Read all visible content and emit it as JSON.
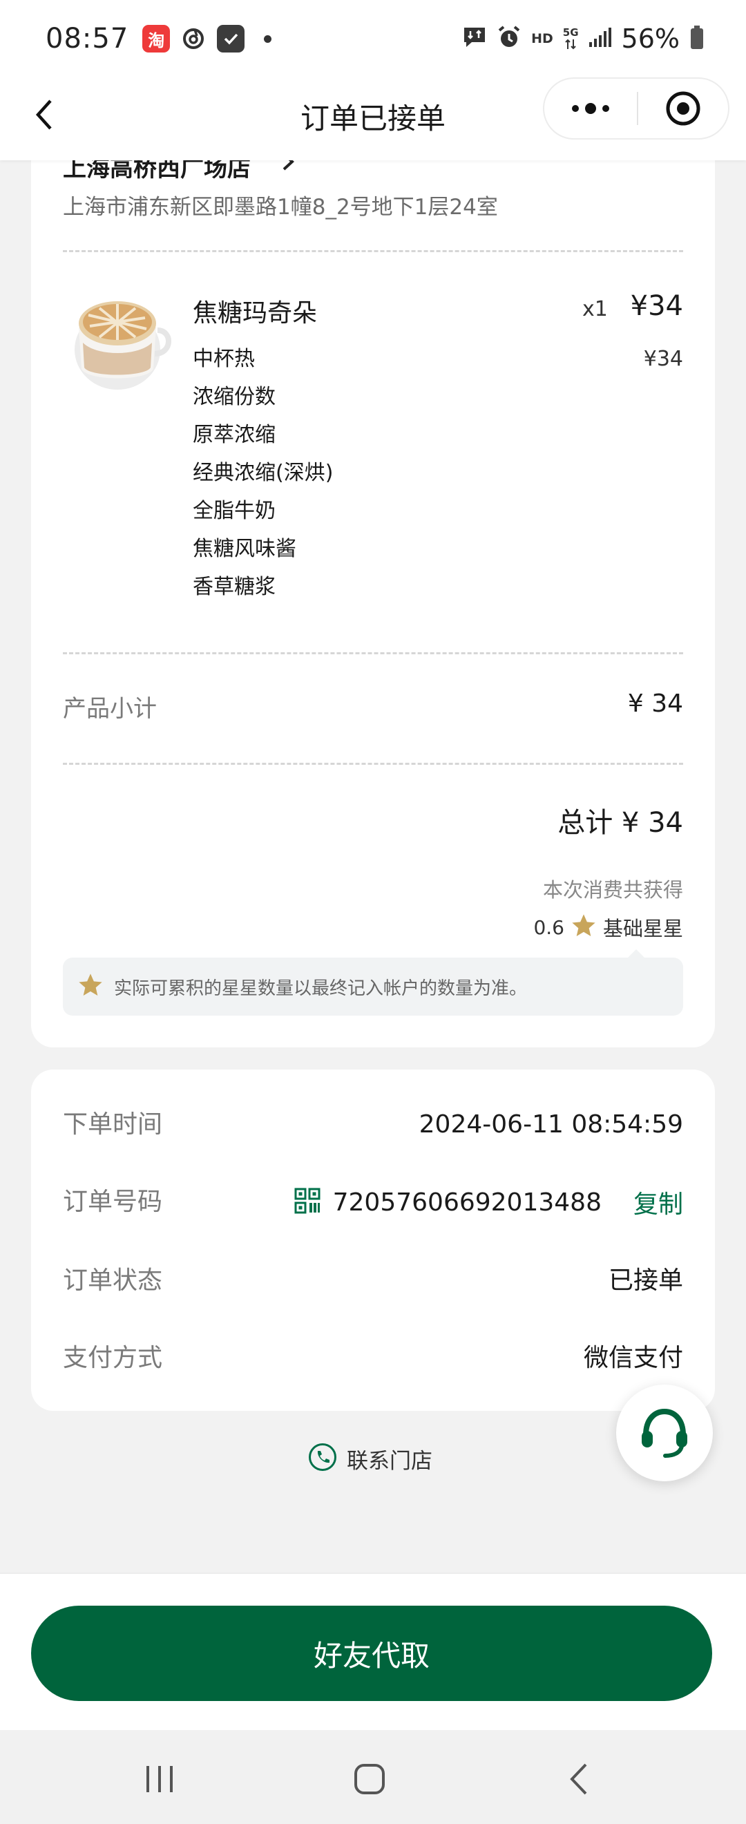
{
  "status_bar": {
    "time": "08:57",
    "taobao_glyph": "淘",
    "hd": "HD",
    "net": "5G",
    "battery": "56%"
  },
  "nav": {
    "title": "订单已接单"
  },
  "store": {
    "name": "上海高桥西广场店",
    "address": "上海市浦东新区即墨路1幢8_2号地下1层24室"
  },
  "product": {
    "name": "焦糖玛奇朵",
    "qty": "x1",
    "price": "¥34",
    "options": [
      "中杯热",
      "浓缩份数",
      "原萃浓缩",
      "经典浓缩(深烘)",
      "全脂牛奶",
      "焦糖风味酱",
      "香草糖浆"
    ],
    "option_price": "¥34"
  },
  "subtotal": {
    "label": "产品小计",
    "value": "¥ 34"
  },
  "total": "总计 ¥ 34",
  "stars": {
    "label": "本次消费共获得",
    "value": "0.6",
    "text": "基础星星",
    "notice": "实际可累积的星星数量以最终记入帐户的数量为准。"
  },
  "info": {
    "time_label": "下单时间",
    "time_value": "2024-06-11 08:54:59",
    "order_label": "订单号码",
    "order_value": "72057606692013488",
    "copy": "复制",
    "status_label": "订单状态",
    "status_value": "已接单",
    "pay_label": "支付方式",
    "pay_value": "微信支付"
  },
  "contact": "联系门店",
  "friend_button": "好友代取",
  "colors": {
    "brand_green": "#00643c",
    "accent_green": "#00704a",
    "star_gold": "#c8a55b"
  }
}
